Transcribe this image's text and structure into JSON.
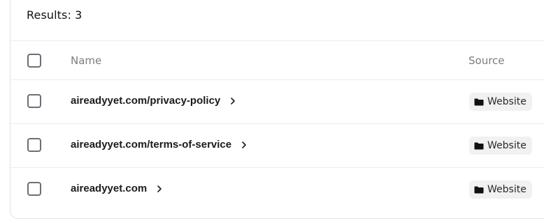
{
  "results": {
    "label": "Results: 3"
  },
  "columns": {
    "name": "Name",
    "source": "Source"
  },
  "rows": [
    {
      "name": "aireadyyet.com/privacy-policy",
      "source": "Website",
      "source_icon": "folder-icon"
    },
    {
      "name": "aireadyyet.com/terms-of-service",
      "source": "Website",
      "source_icon": "folder-icon"
    },
    {
      "name": "aireadyyet.com",
      "source": "Website",
      "source_icon": "folder-icon"
    }
  ],
  "colors": {
    "text": "#1b1b1b",
    "muted": "#7a7d84",
    "border": "#ececec",
    "badge_bg": "#f1f1f1",
    "checkbox_border": "#6b6f77"
  }
}
